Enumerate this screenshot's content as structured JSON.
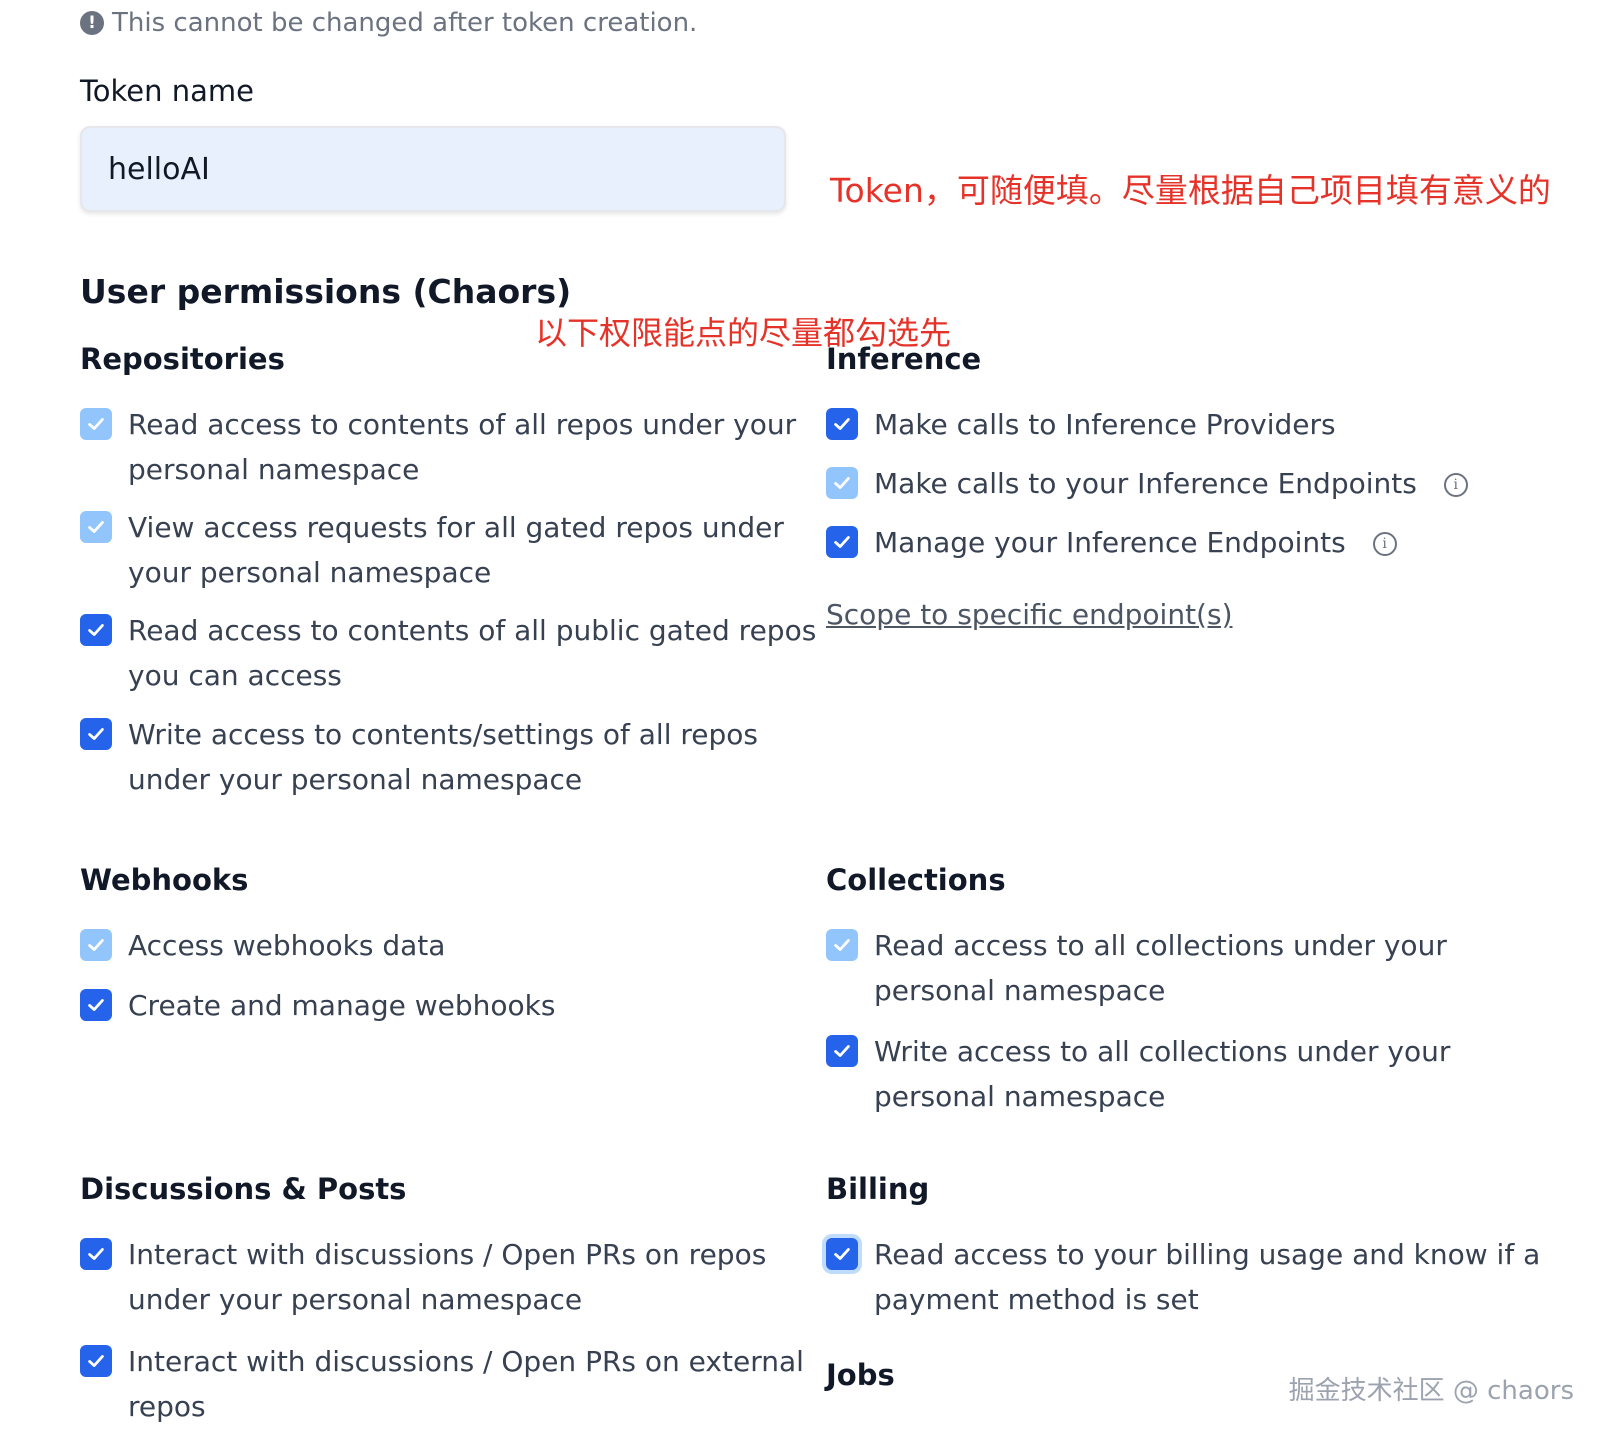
{
  "notice": {
    "text": "This cannot be changed after token creation."
  },
  "token": {
    "label": "Token name",
    "value": "helloAI",
    "annotation": "Token，可随便填。尽量根据自己项目填有意义的"
  },
  "permissions": {
    "title": "User permissions (Chaors)",
    "annotation": "以下权限能点的尽量都勾选先",
    "repositories": {
      "title": "Repositories",
      "items": [
        {
          "line1": "Read access to contents of all repos under your",
          "line2": "personal namespace",
          "checked": true
        },
        {
          "line1": "View access requests for all gated repos under",
          "line2": "your personal namespace",
          "checked": true
        },
        {
          "line1": "Read access to contents of all public gated repos",
          "line2": "you can access",
          "checked": true
        },
        {
          "line1": "Write access to contents/settings of all repos",
          "line2": "under your personal namespace",
          "checked": true
        }
      ]
    },
    "inference": {
      "title": "Inference",
      "items": [
        {
          "text": "Make calls to Inference Providers",
          "checked": true
        },
        {
          "text": "Make calls to your Inference Endpoints",
          "checked": true
        },
        {
          "text": "Manage your Inference Endpoints",
          "checked": true
        }
      ],
      "scope_link": "Scope to specific endpoint(s)"
    },
    "webhooks": {
      "title": "Webhooks",
      "items": [
        {
          "text": "Access webhooks data",
          "checked": true
        },
        {
          "text": "Create and manage webhooks",
          "checked": true
        }
      ]
    },
    "collections": {
      "title": "Collections",
      "items": [
        {
          "line1": "Read access to all collections under your",
          "line2": "personal namespace",
          "checked": true
        },
        {
          "line1": "Write access to all collections under your",
          "line2": "personal namespace",
          "checked": true
        }
      ]
    },
    "discussions": {
      "title": "Discussions & Posts",
      "items": [
        {
          "line1": "Interact with discussions / Open PRs on repos",
          "line2": "under your personal namespace",
          "checked": true
        },
        {
          "line1": "Interact with discussions / Open PRs on external",
          "line2": "repos",
          "checked": true
        }
      ]
    },
    "billing": {
      "title": "Billing",
      "items": [
        {
          "line1": "Read access to your billing usage and know if a",
          "line2": "payment method is set",
          "checked": true
        }
      ]
    },
    "jobs": {
      "title": "Jobs"
    }
  },
  "watermark": "掘金技术社区 @ chaors",
  "colors": {
    "checkbox_active": "#2563eb",
    "checkbox_disabled": "#93c5fd",
    "annotation": "#e5332a",
    "input_bg": "#e8effd"
  }
}
